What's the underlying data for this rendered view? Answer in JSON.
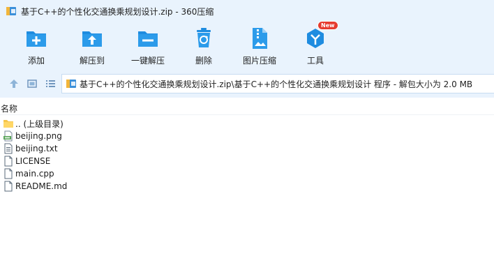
{
  "window": {
    "title": "基于C++的个性化交通换乘规划设计.zip - 360压缩"
  },
  "toolbar": {
    "add_label": "添加",
    "extract_label": "解压到",
    "oneclick_label": "一键解压",
    "delete_label": "删除",
    "image_compress_label": "图片压缩",
    "tools_label": "工具",
    "tools_badge": "New"
  },
  "address": {
    "path": "基于C++的个性化交通换乘规划设计.zip\\基于C++的个性化交通换乘规划设计 程序 - 解包大小为 2.0 MB"
  },
  "list": {
    "column_name": "名称",
    "items": [
      {
        "name": ".. (上级目录)",
        "icon": "folder-icon"
      },
      {
        "name": "beijing.png",
        "icon": "png-file-icon"
      },
      {
        "name": "beijing.txt",
        "icon": "text-file-icon"
      },
      {
        "name": "LICENSE",
        "icon": "file-icon"
      },
      {
        "name": "main.cpp",
        "icon": "file-icon"
      },
      {
        "name": "README.md",
        "icon": "file-icon"
      }
    ]
  },
  "colors": {
    "toolbar_bg": "#e9f3fd",
    "icon_blue": "#1e8ce0",
    "badge_red": "#e63b2e"
  }
}
